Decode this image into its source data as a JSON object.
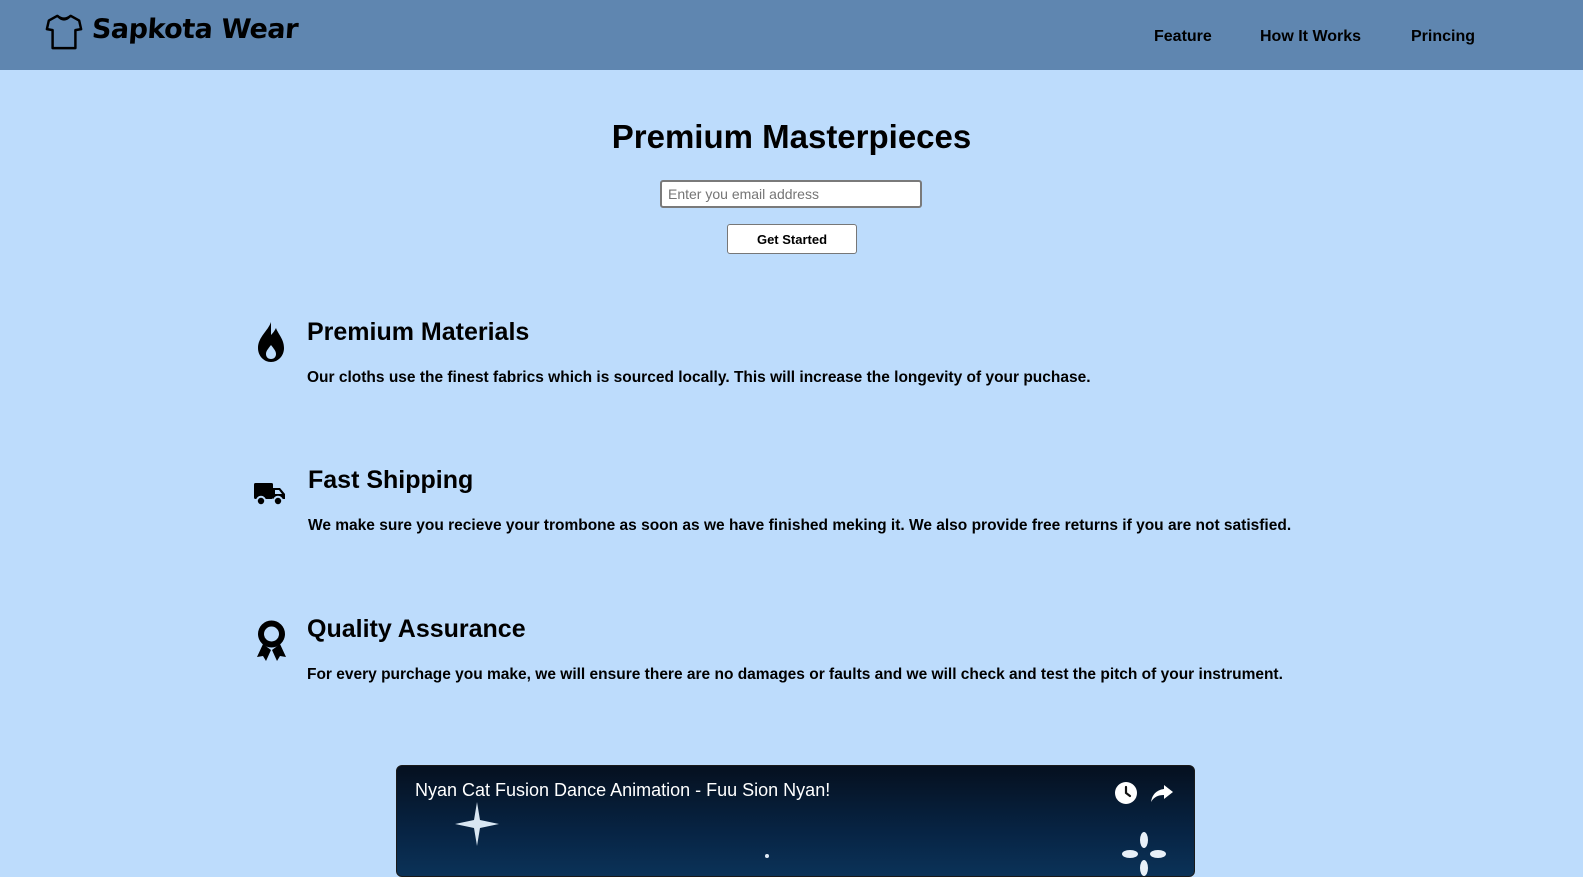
{
  "header": {
    "brand": "Sapkota Wear",
    "logo_icon": "tshirt-icon",
    "nav": [
      "Feature",
      "How It Works",
      "Princing"
    ]
  },
  "hero": {
    "title": "Premium Masterpieces",
    "email_placeholder": "Enter you email address",
    "email_value": "",
    "cta_label": "Get Started"
  },
  "features": [
    {
      "icon": "fire-icon",
      "title": "Premium Materials",
      "text": "Our cloths use the finest fabrics which is sourced locally. This will increase the longevity of your puchase."
    },
    {
      "icon": "truck-icon",
      "title": "Fast Shipping",
      "text": "We make sure you recieve your trombone as soon as we have finished meking it. We also provide free returns if you are not satisfied."
    },
    {
      "icon": "award-icon",
      "title": "Quality Assurance",
      "text": "For every purchage you make, we will ensure there are no damages or faults and we will check and test the pitch of your instrument."
    }
  ],
  "video": {
    "title": "Nyan Cat Fusion Dance Animation - Fuu Sion Nyan!",
    "icons": [
      "watch-later-icon",
      "share-icon"
    ]
  },
  "colors": {
    "background": "#bddcfc",
    "header": "#5f86b0",
    "text": "#000000"
  }
}
